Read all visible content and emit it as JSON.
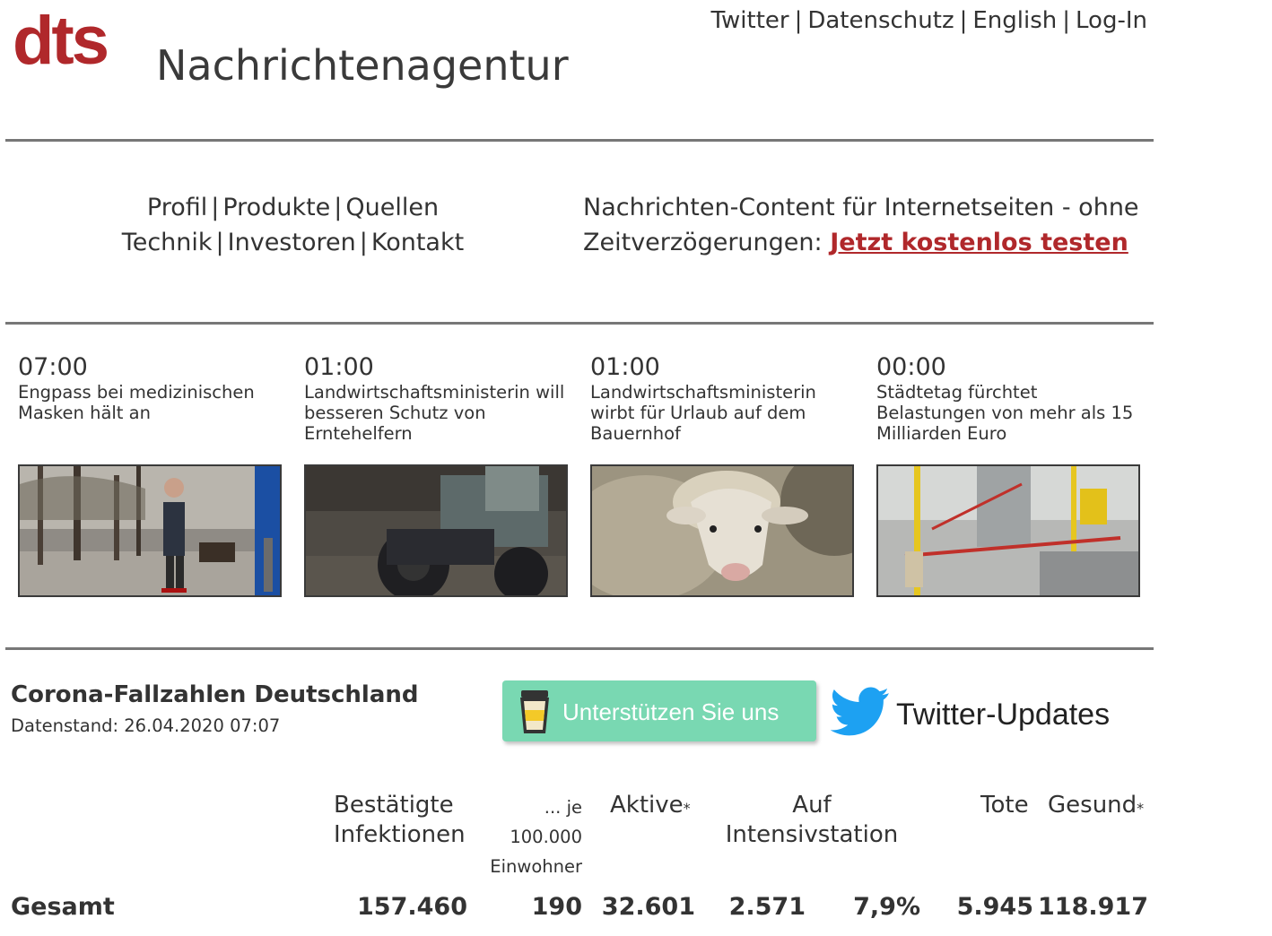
{
  "header": {
    "logo_mark": "dts",
    "logo_name": "Nachrichtenagentur",
    "top_links": [
      "Twitter",
      "Datenschutz",
      "English",
      "Log-In"
    ]
  },
  "nav": {
    "row1": [
      "Profil",
      "Produkte",
      "Quellen"
    ],
    "row2": [
      "Technik",
      "Investoren",
      "Kontakt"
    ]
  },
  "promo": {
    "text_line1": "Nachrichten-Content für Internetseiten - ohne",
    "text_line2": "Zeitverzögerungen:",
    "cta": "Jetzt kostenlos testen"
  },
  "news": [
    {
      "time": "07:00",
      "title": "Engpass bei medizinischen Masken hält an"
    },
    {
      "time": "01:00",
      "title": "Landwirtschaftsministerin will besseren Schutz von Erntehelfern"
    },
    {
      "time": "01:00",
      "title": "Landwirtschaftsministerin wirbt für Urlaub auf dem Bauernhof"
    },
    {
      "time": "00:00",
      "title": "Städtetag fürchtet Belastungen von mehr als 15 Milliarden Euro"
    }
  ],
  "corona": {
    "title": "Corona-Fallzahlen Deutschland",
    "date": "Datenstand: 26.04.2020 07:07",
    "support_label": "Unterstützen Sie uns",
    "twitter_label": "Twitter-Updates",
    "headers": {
      "confirmed_1": "Bestätigte",
      "confirmed_2": "Infektionen",
      "per100k_1": "... je",
      "per100k_2": "100.000",
      "per100k_3": "Einwohner",
      "active": "Aktive",
      "icu_1": "Auf",
      "icu_2": "Intensivstation",
      "dead": "Tote",
      "recovered": "Gesund",
      "asterisk": "*"
    },
    "row": {
      "label": "Gesamt",
      "confirmed": "157.460",
      "per100k": "190",
      "active": "32.601",
      "icu": "2.571",
      "icu_pct": "7,9%",
      "dead": "5.945",
      "recovered": "118.917"
    }
  },
  "colors": {
    "brand_red": "#b0282b",
    "support_green": "#79d8b2",
    "twitter_blue": "#1da1f2"
  }
}
